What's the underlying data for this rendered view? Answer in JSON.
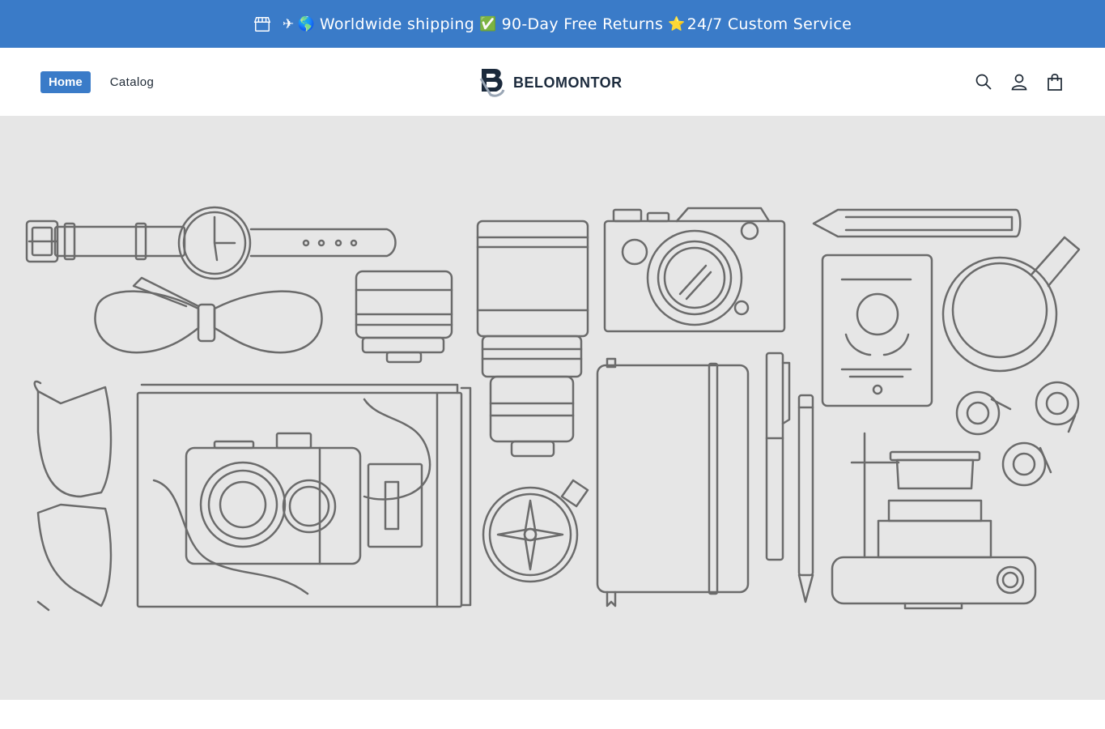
{
  "announcement": {
    "icons": [
      "store-icon",
      "airplane-icon",
      "globe-icon",
      "check-mark-icon",
      "star-icon"
    ],
    "shipping": "Worldwide shipping",
    "returns": "90-Day Free Returns",
    "service": "24/7 Custom Service"
  },
  "nav": {
    "home": "Home",
    "catalog": "Catalog"
  },
  "logo": {
    "text": "BELOMONTOR"
  },
  "header_icons": [
    "search-icon",
    "account-icon",
    "cart-icon"
  ],
  "hero": {
    "image": "travel-gear-line-illustration",
    "colors": {
      "background": "#e6e6e6",
      "line": "#6b6b6b"
    }
  },
  "colors": {
    "brand": "#3a7bc8",
    "text": "#1f2a36"
  }
}
